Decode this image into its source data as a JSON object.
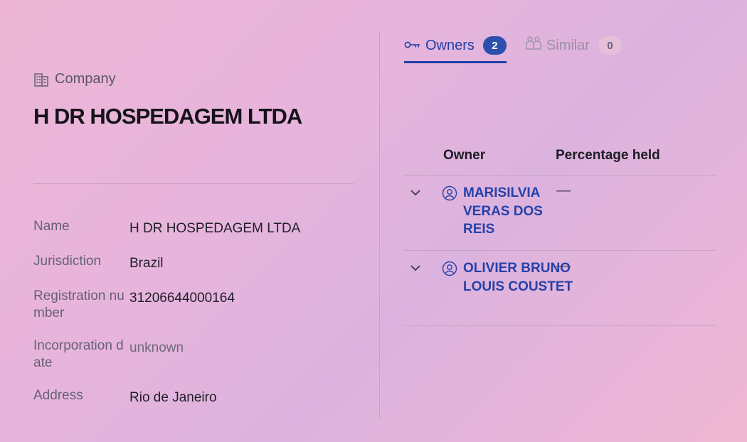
{
  "entity": {
    "type_label": "Company",
    "title": "H DR HOSPEDAGEM LTDA"
  },
  "properties": [
    {
      "label": "Name",
      "value": "H DR HOSPEDAGEM LTDA",
      "muted": false
    },
    {
      "label": "Jurisdiction",
      "value": "Brazil",
      "muted": false
    },
    {
      "label": "Registration number",
      "value": "31206644000164",
      "muted": false
    },
    {
      "label": "Incorporation date",
      "value": "unknown",
      "muted": true
    },
    {
      "label": "Address",
      "value": "Rio de Janeiro",
      "muted": false
    }
  ],
  "tabs": {
    "owners": {
      "label": "Owners",
      "count": "2",
      "icon": "key-icon"
    },
    "similar": {
      "label": "Similar",
      "count": "0",
      "icon": "people-icon"
    }
  },
  "owners_table": {
    "headers": {
      "owner": "Owner",
      "percentage": "Percentage held"
    },
    "rows": [
      {
        "name": "MARISILVIA VERAS DOS REIS",
        "percentage": "—"
      },
      {
        "name": "OLIVIER BRUNO LOUIS COUSTET",
        "percentage": "—"
      }
    ]
  },
  "colors": {
    "accent": "#2140a8",
    "link": "#2541a8"
  }
}
